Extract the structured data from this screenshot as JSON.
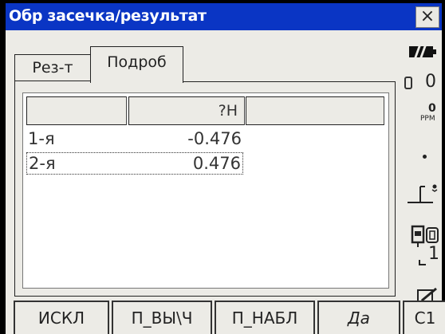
{
  "window": {
    "title": "Обр засечка/результат",
    "close_label": "×"
  },
  "tabs": [
    {
      "label": "Рез-т",
      "active": false
    },
    {
      "label": "Подроб",
      "active": true
    }
  ],
  "table": {
    "columns": [
      "",
      "?H",
      ""
    ],
    "rows": [
      {
        "name": "1-я",
        "value": "-0.476",
        "selected": false
      },
      {
        "name": "2-я",
        "value": "0.476",
        "selected": true
      }
    ]
  },
  "status_bar": {
    "battery_icon": "battery-full-icon",
    "prism_constant": "0",
    "ppm_value": "0",
    "ppm_label": "PPM",
    "tilt_icon": "level-icon",
    "instrument_icon": "instrument-icon",
    "face_value": "1",
    "input_icon": "pen-icon"
  },
  "softkeys": [
    "ИСКЛ",
    "П_ВЫ\\Ч",
    "П_НАБЛ",
    "Да",
    "C1"
  ]
}
